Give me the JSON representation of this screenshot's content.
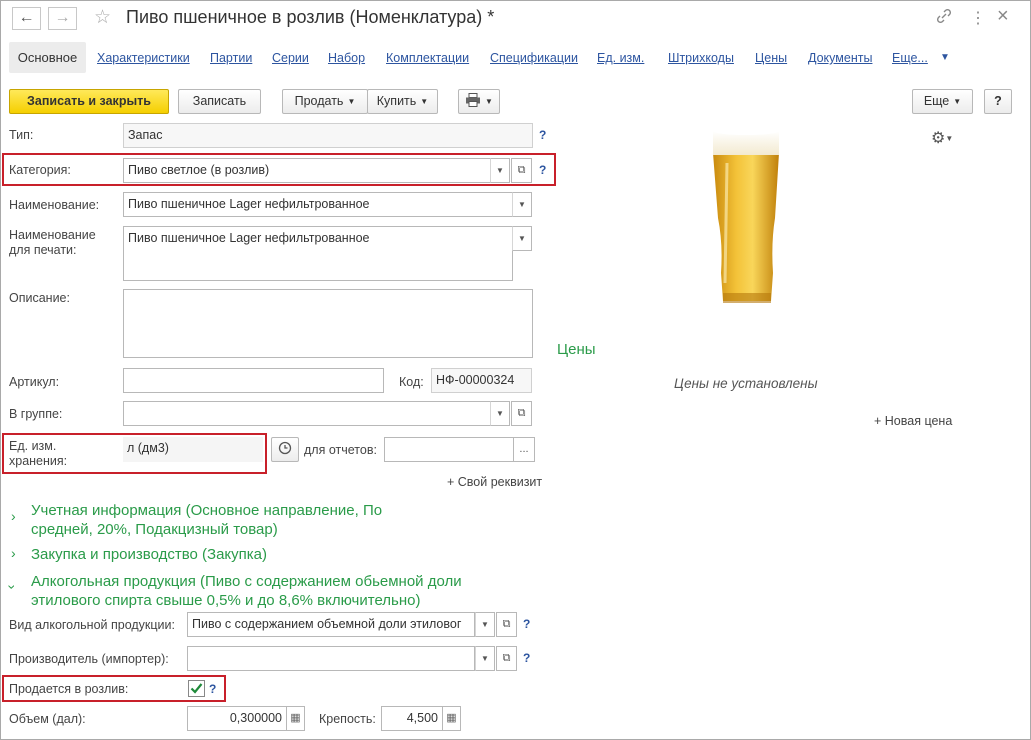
{
  "window": {
    "title": "Пиво пшеничное в розлив (Номенклатура) *",
    "back_label": "←",
    "forward_label": "→",
    "star_icon": "☆",
    "link_icon": "⛓",
    "more_icon": "⋮",
    "close_icon": "×"
  },
  "tabs": {
    "active": "Основное",
    "items": [
      "Характеристики",
      "Партии",
      "Серии",
      "Набор",
      "Комплектации",
      "Спецификации",
      "Ед. изм.",
      "Штрихкоды",
      "Цены",
      "Документы",
      "Еще..."
    ]
  },
  "toolbar": {
    "save_close": "Записать и закрыть",
    "save": "Записать",
    "sell": "Продать",
    "buy": "Купить",
    "more": "Еще",
    "help": "?"
  },
  "form": {
    "type_label": "Тип:",
    "type_value": "Запас",
    "category_label": "Категория:",
    "category_value": "Пиво светлое (в розлив)",
    "name_label": "Наименование:",
    "name_value": "Пиво пшеничное Lager нефильтрованное",
    "print_name_label_1": "Наименование",
    "print_name_label_2": "для печати:",
    "print_name_value": "Пиво пшеничное Lager нефильтрованное",
    "description_label": "Описание:",
    "description_value": "",
    "article_label": "Артикул:",
    "article_value": "",
    "code_label": "Код:",
    "code_value": "НФ-00000324",
    "group_label": "В группе:",
    "group_value": "",
    "unit_label_1": "Ед. изм.",
    "unit_label_2": "хранения:",
    "unit_value": "л (дм3)",
    "report_unit_label": "для отчетов:",
    "report_unit_value": "",
    "add_attr": "+ Свой реквизит",
    "help": "?"
  },
  "groups": {
    "accounting_1": "Учетная информация (Основное направление, По",
    "accounting_2": "средней, 20%, Подакцизный товар)",
    "purchase": "Закупка и производство (Закупка)",
    "alcohol_1": "Алкогольная продукция (Пиво с содержанием обьемной доли",
    "alcohol_2": "этилового спирта свыше 0,5% и до 8,6% включительно)"
  },
  "alcohol": {
    "kind_label": "Вид алкогольной продукции:",
    "kind_value": "Пиво с содержанием объемной доли этиловог",
    "producer_label": "Производитель (импортер):",
    "producer_value": "",
    "draft_label": "Продается в розлив:",
    "draft_checked": true,
    "volume_label": "Объем (дал):",
    "volume_value": "0,300000",
    "strength_label": "Крепость:",
    "strength_value": "4,500"
  },
  "prices": {
    "title": "Цены",
    "empty": "Цены не установлены",
    "new_price": "+ Новая цена"
  },
  "colors": {
    "accent_green": "#2a9b49",
    "link_blue": "#2d55a0",
    "highlight_red": "#c8202a",
    "primary_yellow": "#f5cf00"
  }
}
